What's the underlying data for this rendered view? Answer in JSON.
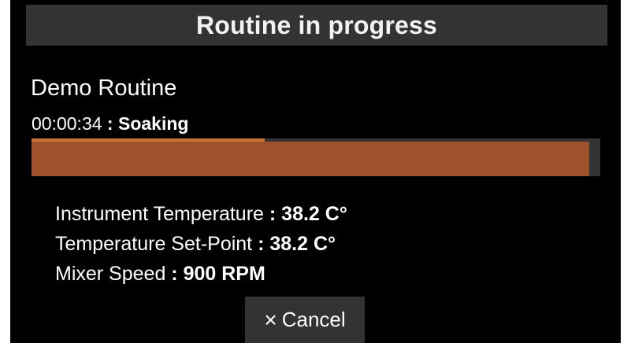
{
  "header": {
    "title": "Routine in progress"
  },
  "routine": {
    "name": "Demo Routine",
    "elapsed": "00:00:34",
    "separator": " : ",
    "phase": "Soaking",
    "step_progress_fraction": 0.41,
    "overall_progress_fraction": 0.98
  },
  "readouts": [
    {
      "label": "Instrument Temperature",
      "separator": " : ",
      "value": "38.2 C°"
    },
    {
      "label": "Temperature Set-Point",
      "separator": " : ",
      "value": "38.2 C°"
    },
    {
      "label": "Mixer Speed",
      "separator": " : ",
      "value": "900 RPM"
    }
  ],
  "actions": {
    "cancel_label": "Cancel",
    "cancel_icon": "close-icon"
  },
  "colors": {
    "background": "#000000",
    "header_bg": "#333333",
    "progress_fill": "#a0522d",
    "step_fill": "#c87533",
    "track": "#333333"
  }
}
